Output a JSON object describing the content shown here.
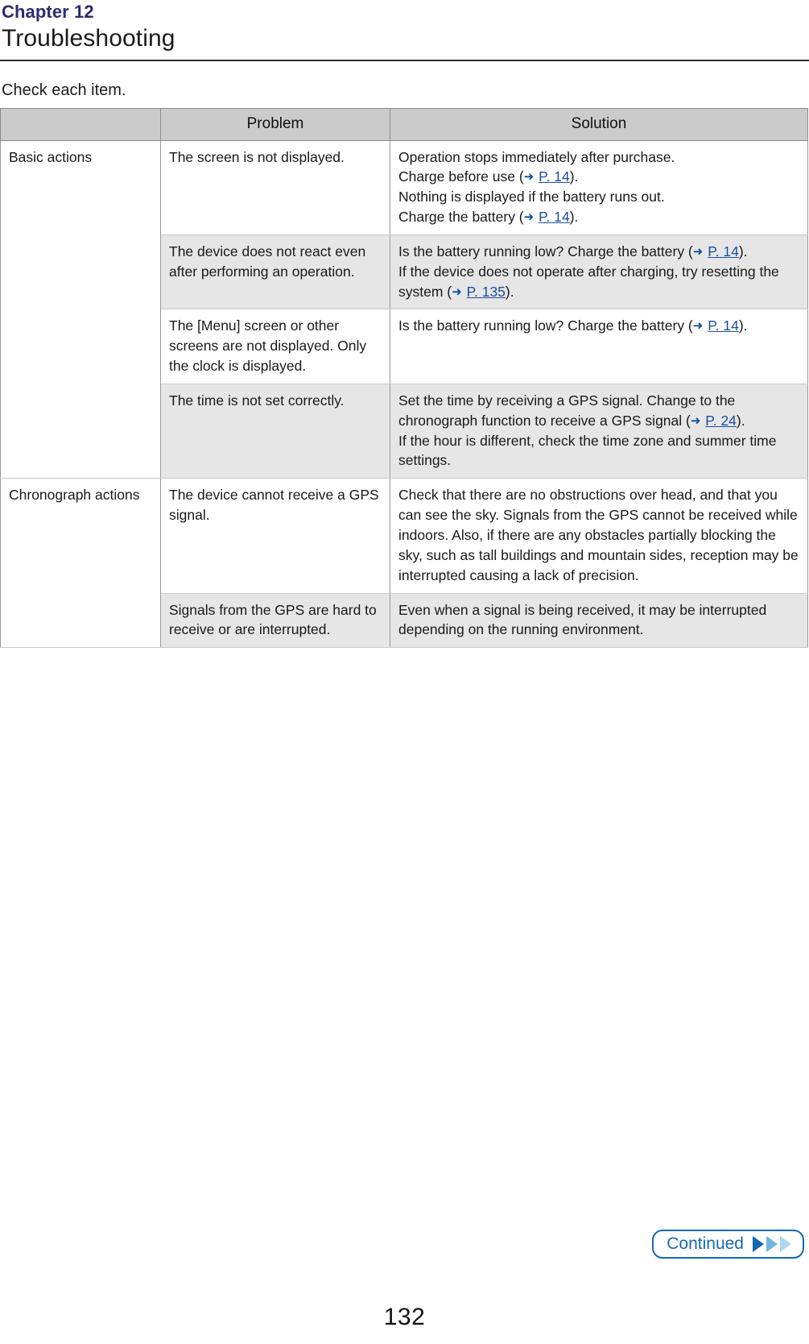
{
  "header": {
    "chapter_label": "Chapter 12",
    "chapter_title": "Troubleshooting"
  },
  "intro": "Check each item.",
  "table": {
    "columns": {
      "category": "",
      "problem": "Problem",
      "solution": "Solution"
    },
    "sections": [
      {
        "category": "Basic actions",
        "rows": [
          {
            "problem": "The screen is not displayed.",
            "solution_lines": [
              {
                "text_before": "Operation stops immediately after purchase.",
                "link": null,
                "text_after": ""
              },
              {
                "text_before": "Charge before use (",
                "link": "P. 14",
                "text_after": ")."
              },
              {
                "text_before": "Nothing is displayed if the battery runs out.",
                "link": null,
                "text_after": ""
              },
              {
                "text_before": "Charge the battery (",
                "link": "P. 14",
                "text_after": ")."
              }
            ],
            "shaded": false
          },
          {
            "problem": "The device does not react even after performing an operation.",
            "solution_lines": [
              {
                "text_before": "Is the battery running low? Charge the battery (",
                "link": "P. 14",
                "text_after": ")."
              },
              {
                "text_before": "If the device does not operate after charging, try resetting the system (",
                "link": "P. 135",
                "text_after": ")."
              }
            ],
            "shaded": true
          },
          {
            "problem": "The [Menu] screen or other screens are not displayed. Only the clock is displayed.",
            "solution_lines": [
              {
                "text_before": "Is the battery running low? Charge the battery (",
                "link": "P. 14",
                "text_after": ")."
              }
            ],
            "shaded": false
          },
          {
            "problem": "The time is not set correctly.",
            "solution_lines": [
              {
                "text_before": "Set the time by receiving a GPS signal. Change to the chronograph function to receive a GPS signal (",
                "link": "P. 24",
                "text_after": ")."
              },
              {
                "text_before": "If the hour is different, check the time zone and summer time settings.",
                "link": null,
                "text_after": ""
              }
            ],
            "shaded": true
          }
        ]
      },
      {
        "category": "Chronograph actions",
        "rows": [
          {
            "problem": "The device cannot receive a GPS signal.",
            "solution_lines": [
              {
                "text_before": "Check that there are no obstructions over head, and that you can see the sky. Signals from the GPS cannot be received while indoors. Also, if there are any obstacles partially blocking the sky, such as tall buildings and mountain sides, reception may be interrupted causing a lack of precision.",
                "link": null,
                "text_after": ""
              }
            ],
            "shaded": false
          },
          {
            "problem": "Signals from the GPS are hard to receive or are interrupted.",
            "solution_lines": [
              {
                "text_before": "Even when a signal is being received, it may be interrupted depending on the running environment.",
                "link": null,
                "text_after": ""
              }
            ],
            "shaded": true
          }
        ]
      }
    ]
  },
  "footer": {
    "continued_label": "Continued",
    "page_number": "132"
  },
  "colors": {
    "chapter_accent": "#2b2d6e",
    "link": "#1d4fa0",
    "button_blue": "#1668b3",
    "header_fill": "#cbcbcb",
    "row_shade": "#e6e6e6"
  }
}
